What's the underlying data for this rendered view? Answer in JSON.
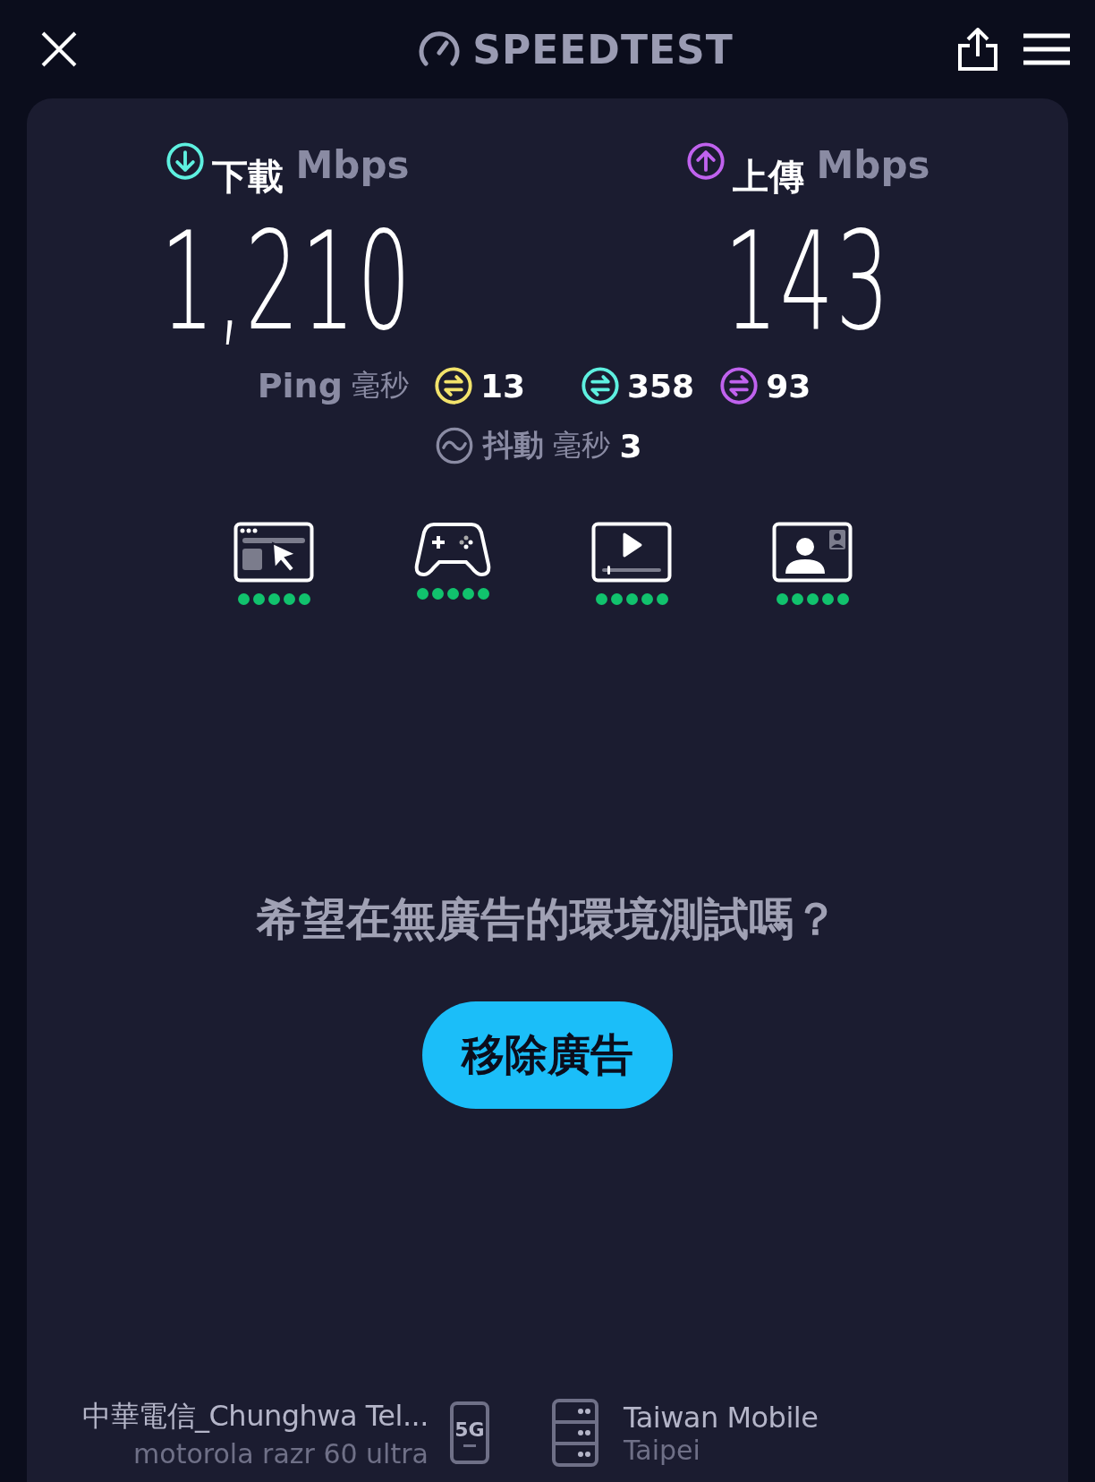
{
  "header": {
    "logo_text": "SPEEDTEST"
  },
  "download": {
    "label": "下載",
    "unit": "Mbps",
    "value": "1,210"
  },
  "upload": {
    "label": "上傳",
    "unit": "Mbps",
    "value": "143"
  },
  "ping": {
    "label": "Ping",
    "unit": "毫秒",
    "readings": [
      {
        "value": "13",
        "color": "#f2e36b"
      },
      {
        "value": "358",
        "color": "#5ef0e0"
      },
      {
        "value": "93",
        "color": "#c062ee"
      }
    ]
  },
  "jitter": {
    "label": "抖動",
    "unit": "毫秒",
    "value": "3"
  },
  "services": [
    {
      "kind": "browsing",
      "stars": 5
    },
    {
      "kind": "gaming",
      "stars": 5
    },
    {
      "kind": "video",
      "stars": 5
    },
    {
      "kind": "video_call",
      "stars": 5
    }
  ],
  "promo": {
    "text": "希望在無廣告的環境測試嗎？",
    "button": "移除廣告"
  },
  "provider": {
    "name": "中華電信_Chunghwa Tel...",
    "device": "motorola razr 60 ultra",
    "network": "5G"
  },
  "server": {
    "name": "Taiwan Mobile",
    "location": "Taipei"
  }
}
